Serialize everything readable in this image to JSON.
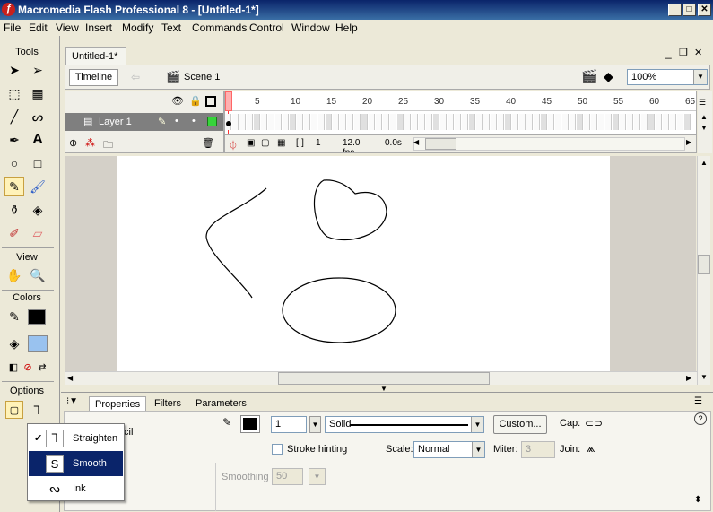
{
  "window": {
    "title": "Macromedia Flash Professional 8 - [Untitled-1*]",
    "min": "_",
    "max": "□",
    "close": "✕"
  },
  "menubar": [
    "File",
    "Edit",
    "View",
    "Insert",
    "Modify",
    "Text",
    "Commands",
    "Control",
    "Window",
    "Help"
  ],
  "tools": {
    "header": "Tools",
    "view_header": "View",
    "colors_header": "Colors",
    "options_header": "Options",
    "selected_tool": "pencil-tool"
  },
  "document": {
    "tab": "Untitled-1*",
    "timeline_button": "Timeline",
    "scene": "Scene 1",
    "zoom": "100%"
  },
  "timeline": {
    "layer_name": "Layer 1",
    "ruler": [
      "1",
      "5",
      "10",
      "15",
      "20",
      "25",
      "30",
      "35",
      "40",
      "45",
      "50",
      "55",
      "60",
      "65"
    ],
    "current_frame": "1",
    "fps": "12.0 fps",
    "elapsed": "0.0s"
  },
  "properties": {
    "tabs": [
      "Properties",
      "Filters",
      "Parameters"
    ],
    "tool_name_fragment": "cil",
    "stroke_height": "1",
    "stroke_style": "Solid",
    "custom_button": "Custom...",
    "cap_label": "Cap:",
    "stroke_hinting_label": "Stroke hinting",
    "scale_label": "Scale:",
    "scale_value": "Normal",
    "miter_label": "Miter:",
    "miter_value": "3",
    "join_label": "Join:",
    "smoothing_label": "Smoothing",
    "smoothing_value": "50",
    "help": "?"
  },
  "pencil_mode_menu": {
    "items": [
      {
        "label": "Straighten",
        "checked": true,
        "highlighted": false,
        "icon": "straighten-icon"
      },
      {
        "label": "Smooth",
        "checked": false,
        "highlighted": true,
        "icon": "smooth-icon"
      },
      {
        "label": "Ink",
        "checked": false,
        "highlighted": false,
        "icon": "ink-icon"
      }
    ]
  },
  "colors": {
    "title_bar": "#0a246a",
    "highlight": "#0a246a",
    "layer_row": "#7f7f7f",
    "playhead": "#ff6666"
  }
}
